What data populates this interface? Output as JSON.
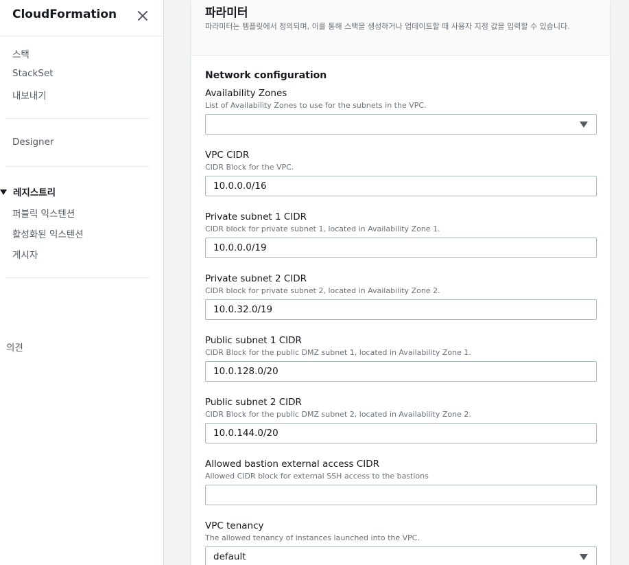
{
  "sidebar": {
    "title": "CloudFormation",
    "items_top": [
      "스택",
      "StackSet",
      "내보내기"
    ],
    "designer": "Designer",
    "registry": {
      "label": "레지스트리",
      "items": [
        "퍼블릭 익스텐션",
        "활성화된 익스텐션",
        "게시자"
      ]
    },
    "feedback": "의견"
  },
  "panel": {
    "title": "파라미터",
    "description": "파라미터는 템플릿에서 정의되며, 이를 통해 스택을 생성하거나 업데이트할 때 사용자 지정 값을 입력할 수 있습니다.",
    "section_title": "Network configuration",
    "fields": [
      {
        "label": "Availability Zones",
        "desc": "List of Availability Zones to use for the subnets in the VPC.",
        "type": "select",
        "value": ""
      },
      {
        "label": "VPC CIDR",
        "desc": "CIDR Block for the VPC.",
        "type": "input",
        "value": "10.0.0.0/16"
      },
      {
        "label": "Private subnet 1 CIDR",
        "desc": "CIDR block for private subnet 1, located in Availability Zone 1.",
        "type": "input",
        "value": "10.0.0.0/19"
      },
      {
        "label": "Private subnet 2 CIDR",
        "desc": "CIDR block for private subnet 2, located in Availability Zone 2.",
        "type": "input",
        "value": "10.0.32.0/19"
      },
      {
        "label": "Public subnet 1 CIDR",
        "desc": "CIDR Block for the public DMZ subnet 1, located in Availability Zone 1.",
        "type": "input",
        "value": "10.0.128.0/20"
      },
      {
        "label": "Public subnet 2 CIDR",
        "desc": "CIDR Block for the public DMZ subnet 2, located in Availability Zone 2.",
        "type": "input",
        "value": "10.0.144.0/20"
      },
      {
        "label": "Allowed bastion external access CIDR",
        "desc": "Allowed CIDR block for external SSH access to the bastions",
        "type": "input",
        "value": ""
      },
      {
        "label": "VPC tenancy",
        "desc": "The allowed tenancy of instances launched into the VPC.",
        "type": "select",
        "value": "default"
      }
    ]
  }
}
